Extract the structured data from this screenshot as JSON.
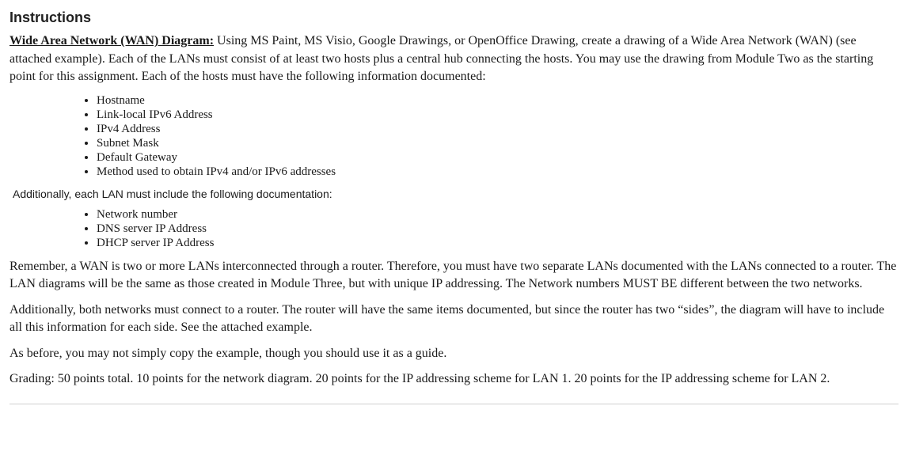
{
  "heading": "Instructions",
  "intro": {
    "lead": "Wide Area Network (WAN) Diagram:",
    "body": " Using MS Paint, MS Visio, Google Drawings, or OpenOffice Drawing, create a drawing of a Wide Area Network (WAN) (see attached example).  Each of the LANs must consist of at least two hosts plus a central hub connecting the hosts.  You may use the drawing from Module Two as the starting point for this assignment.  Each of the hosts must have the following information documented:"
  },
  "host_items": [
    "Hostname",
    "Link-local IPv6 Address",
    "IPv4 Address",
    "Subnet Mask",
    "Default Gateway",
    "Method used to obtain IPv4 and/or IPv6 addresses"
  ],
  "lan_subhead": "Additionally, each LAN must include the following documentation:",
  "lan_items": [
    "Network number",
    "DNS server IP Address",
    "DHCP server IP Address"
  ],
  "para_remember": "Remember, a WAN is two or more LANs interconnected through a router.  Therefore, you must have two separate LANs documented with the LANs connected to a router.  The LAN diagrams will be the same as those created in Module Three, but with unique IP addressing.  The Network numbers MUST BE different between the two networks.",
  "para_router": "Additionally, both networks must connect to a router.  The router will have the same items documented, but since the router has two “sides”, the diagram will have to include all this information for each side.  See the attached example.",
  "para_guide": "As before, you may not simply copy the example, though you should use it as a guide.",
  "para_grading": "Grading: 50 points total.  10 points for the network diagram.  20 points for the IP addressing scheme for LAN 1.  20 points for the IP addressing scheme for LAN 2."
}
